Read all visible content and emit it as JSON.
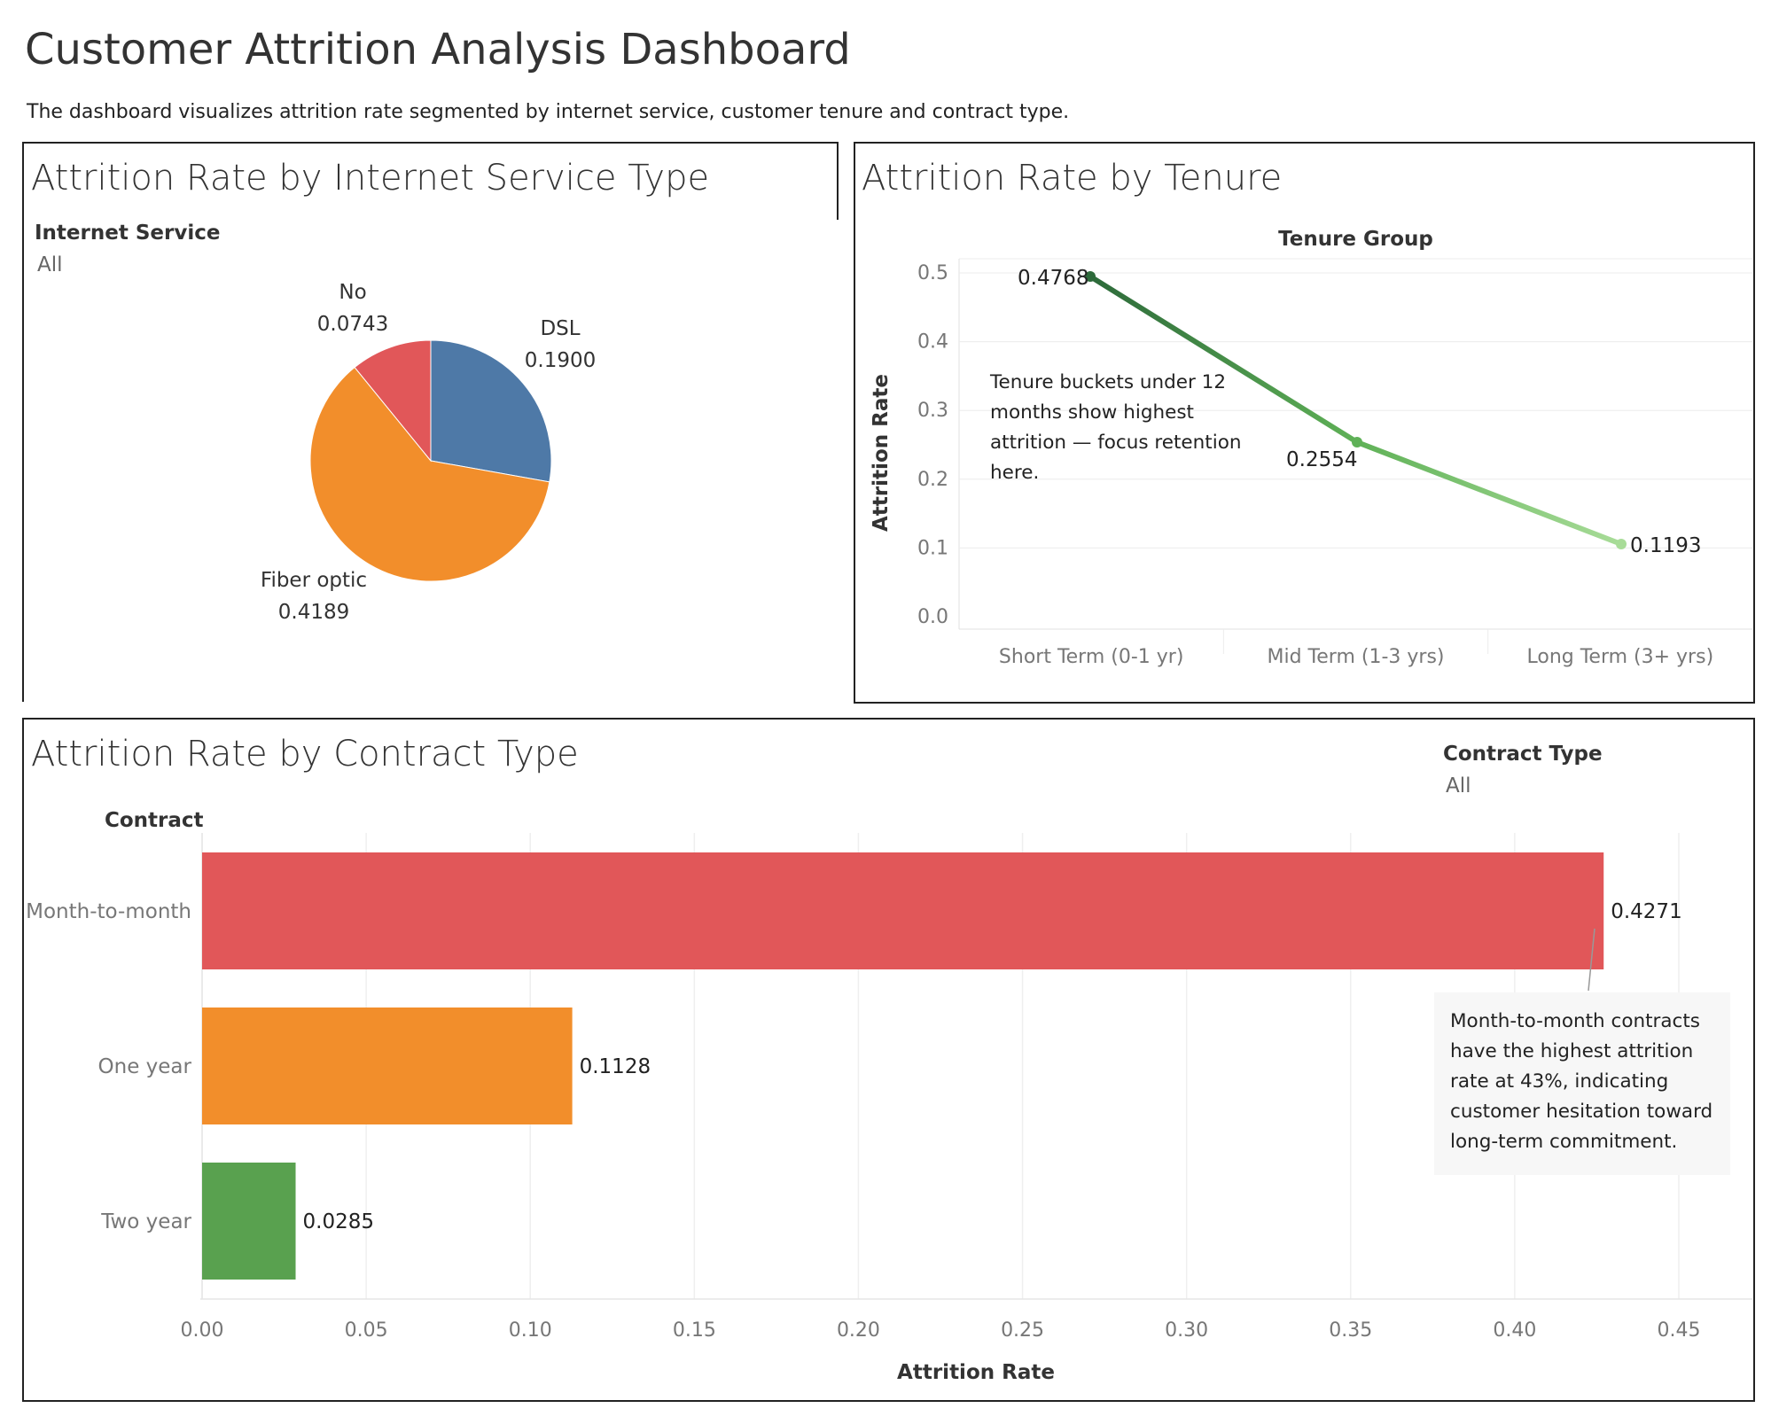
{
  "header": {
    "title": "Customer Attrition Analysis Dashboard",
    "description": "The dashboard visualizes attrition rate segmented by internet service, customer tenure and contract type."
  },
  "internet_panel": {
    "title": "Attrition Rate by Internet Service Type",
    "filter_label": "Internet Service",
    "filter_value": "All"
  },
  "tenure_panel": {
    "title": "Attrition Rate by Tenure",
    "annotation": "Tenure buckets under 12 months show highest attrition — focus retention here."
  },
  "contract_panel": {
    "title": "Attrition Rate by Contract Type",
    "filter_label": "Contract Type",
    "filter_value": "All",
    "annotation": "Month-to-month contracts have the highest attrition rate at 43%, indicating customer hesitation toward long-term commitment."
  },
  "colors": {
    "dsl": "#4e79a7",
    "fiber": "#f28e2b",
    "no": "#e15759",
    "month": "#e15759",
    "one_year": "#f28e2b",
    "two_year": "#59a14f",
    "line_dark": "#2d6a3a",
    "line_light": "#a8dc98"
  },
  "chart_data": [
    {
      "type": "pie",
      "categories": [
        "DSL",
        "Fiber optic",
        "No"
      ],
      "values": [
        0.19,
        0.4189,
        0.0743
      ],
      "labels": [
        "0.1900",
        "0.4189",
        "0.0743"
      ]
    },
    {
      "type": "line",
      "title": "Tenure Group",
      "ylabel": "Attrition Rate",
      "x": [
        "Short Term (0-1 yr)",
        "Mid Term (1-3 yrs)",
        "Long Term (3+ yrs)"
      ],
      "values": [
        0.4768,
        0.2554,
        0.1193
      ],
      "labels": [
        "0.4768",
        "0.2554",
        "0.1193"
      ],
      "ylim": [
        0,
        0.5
      ],
      "yticks": [
        "0.0",
        "0.1",
        "0.2",
        "0.3",
        "0.4",
        "0.5"
      ],
      "grid": true
    },
    {
      "type": "bar",
      "orientation": "horizontal",
      "category_axis_label": "Contract",
      "xlabel": "Attrition Rate",
      "categories": [
        "Month-to-month",
        "One year",
        "Two year"
      ],
      "values": [
        0.4271,
        0.1128,
        0.0285
      ],
      "labels": [
        "0.4271",
        "0.1128",
        "0.0285"
      ],
      "xlim": [
        0,
        0.45
      ],
      "xticks": [
        "0.00",
        "0.05",
        "0.10",
        "0.15",
        "0.20",
        "0.25",
        "0.30",
        "0.35",
        "0.40",
        "0.45"
      ],
      "grid": true
    }
  ]
}
